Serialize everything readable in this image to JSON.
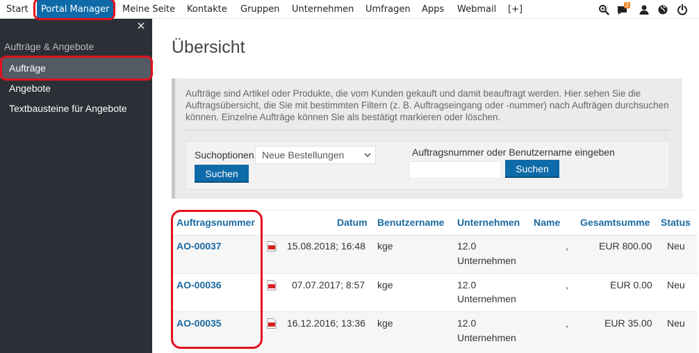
{
  "topnav": {
    "items": [
      {
        "label": "Start"
      },
      {
        "label": "Portal Manager"
      },
      {
        "label": "Meine Seite"
      },
      {
        "label": "Kontakte"
      },
      {
        "label": "Gruppen"
      },
      {
        "label": "Unternehmen"
      },
      {
        "label": "Umfragen"
      },
      {
        "label": "Apps"
      },
      {
        "label": "Webmail"
      },
      {
        "label": "[+]"
      }
    ],
    "active": "Portal Manager",
    "message_badge": "2",
    "accent_color": "#0e6aa8",
    "badge_color": "#f0882a",
    "icons": [
      "search-zoom-icon",
      "chat-icon",
      "user-icon",
      "globe-icon",
      "power-icon"
    ]
  },
  "sidebar": {
    "close_icon": "close-icon",
    "heading": "Aufträge & Angebote",
    "items": [
      {
        "label": "Aufträge"
      },
      {
        "label": "Angebote"
      },
      {
        "label": "Textbausteine für Angebote"
      }
    ],
    "active": "Aufträge"
  },
  "main": {
    "title": "Übersicht",
    "description": "Aufträge sind Artikel oder Produkte, die vom Kunden gekauft und damit beauftragt werden. Hier sehen Sie die Auftragsübersicht, die Sie mit bestimmten Filtern (z. B. Auftragseingang oder -nummer) nach Aufträgen durchsuchen können. Einzelne Aufträge können Sie als bestätigt markieren oder löschen.",
    "filter": {
      "search_options_label": "Suchoptionen",
      "search_options_value": "Neue Bestellungen",
      "search_button": "Suchen",
      "order_search_label": "Auftragsnummer oder Benutzername eingeben",
      "order_search_value": "",
      "order_search_button": "Suchen"
    },
    "table": {
      "headers": [
        "Auftragsnummer",
        "Datum",
        "Benutzername",
        "Unternehmen",
        "Name",
        "Gesamtsumme",
        "Status"
      ],
      "rows": [
        {
          "order": "AO-00037",
          "date": "15.08.2018; 16:48",
          "user": "kge",
          "company_line1": "12.0",
          "company_line2": "Unternehmen",
          "name": ",",
          "total": "EUR 800.00",
          "status": "Neu"
        },
        {
          "order": "AO-00036",
          "date": "07.07.2017; 8:57",
          "user": "kge",
          "company_line1": "12.0",
          "company_line2": "Unternehmen",
          "name": ",",
          "total": "EUR 0.00",
          "status": "Neu"
        },
        {
          "order": "AO-00035",
          "date": "16.12.2016; 13:36",
          "user": "kge",
          "company_line1": "12.0",
          "company_line2": "Unternehmen",
          "name": ",",
          "total": "EUR 35.00",
          "status": "Neu"
        }
      ],
      "pdf_icon": "pdf-icon"
    }
  }
}
